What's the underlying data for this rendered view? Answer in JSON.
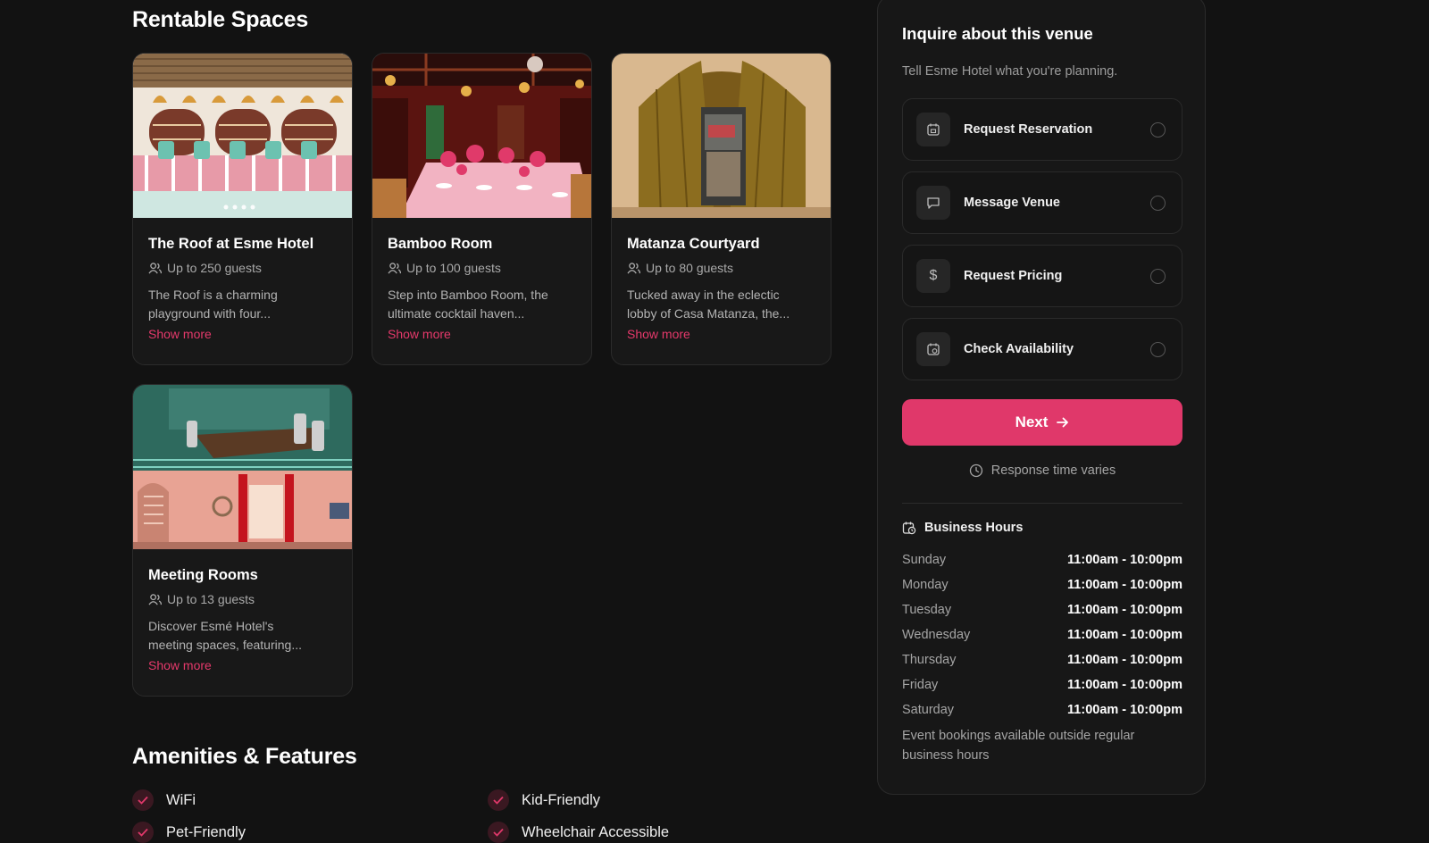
{
  "sections": {
    "rentable_title": "Rentable Spaces",
    "amenities_title": "Amenities & Features"
  },
  "spaces": [
    {
      "title": "The Roof at Esme Hotel",
      "guests": "Up to 250 guests",
      "desc_line1": "The Roof is a charming",
      "desc_line2": "playground with four...",
      "show_more": "Show more"
    },
    {
      "title": "Bamboo Room",
      "guests": "Up to 100 guests",
      "desc_line1": "Step into Bamboo Room, the",
      "desc_line2": "ultimate cocktail haven...",
      "show_more": "Show more"
    },
    {
      "title": "Matanza Courtyard",
      "guests": "Up to 80 guests",
      "desc_line1": "Tucked away in the eclectic",
      "desc_line2": "lobby of Casa Matanza, the...",
      "show_more": "Show more"
    },
    {
      "title": "Meeting Rooms",
      "guests": "Up to 13 guests",
      "desc_line1": "Discover Esmé Hotel's",
      "desc_line2": "meeting spaces, featuring...",
      "show_more": "Show more"
    }
  ],
  "amenities": [
    "WiFi",
    "Kid-Friendly",
    "Pet-Friendly",
    "Wheelchair Accessible"
  ],
  "inquiry": {
    "title": "Inquire about this venue",
    "subtitle": "Tell Esme Hotel what you're planning.",
    "options": [
      {
        "label": "Request Reservation",
        "icon": "calendar-icon"
      },
      {
        "label": "Message Venue",
        "icon": "message-icon"
      },
      {
        "label": "Request Pricing",
        "icon": "dollar-icon"
      },
      {
        "label": "Check Availability",
        "icon": "calendar-check-icon"
      }
    ],
    "next_label": "Next",
    "response_time": "Response time varies"
  },
  "business_hours": {
    "title": "Business Hours",
    "days": [
      {
        "day": "Sunday",
        "time": "11:00am - 10:00pm"
      },
      {
        "day": "Monday",
        "time": "11:00am - 10:00pm"
      },
      {
        "day": "Tuesday",
        "time": "11:00am - 10:00pm"
      },
      {
        "day": "Wednesday",
        "time": "11:00am - 10:00pm"
      },
      {
        "day": "Thursday",
        "time": "11:00am - 10:00pm"
      },
      {
        "day": "Friday",
        "time": "11:00am - 10:00pm"
      },
      {
        "day": "Saturday",
        "time": "11:00am - 10:00pm"
      }
    ],
    "note_line1": "Event bookings available outside regular",
    "note_line2": "business hours"
  },
  "colors": {
    "background": "#121212",
    "accent": "#e0386a",
    "card": "#181818"
  }
}
